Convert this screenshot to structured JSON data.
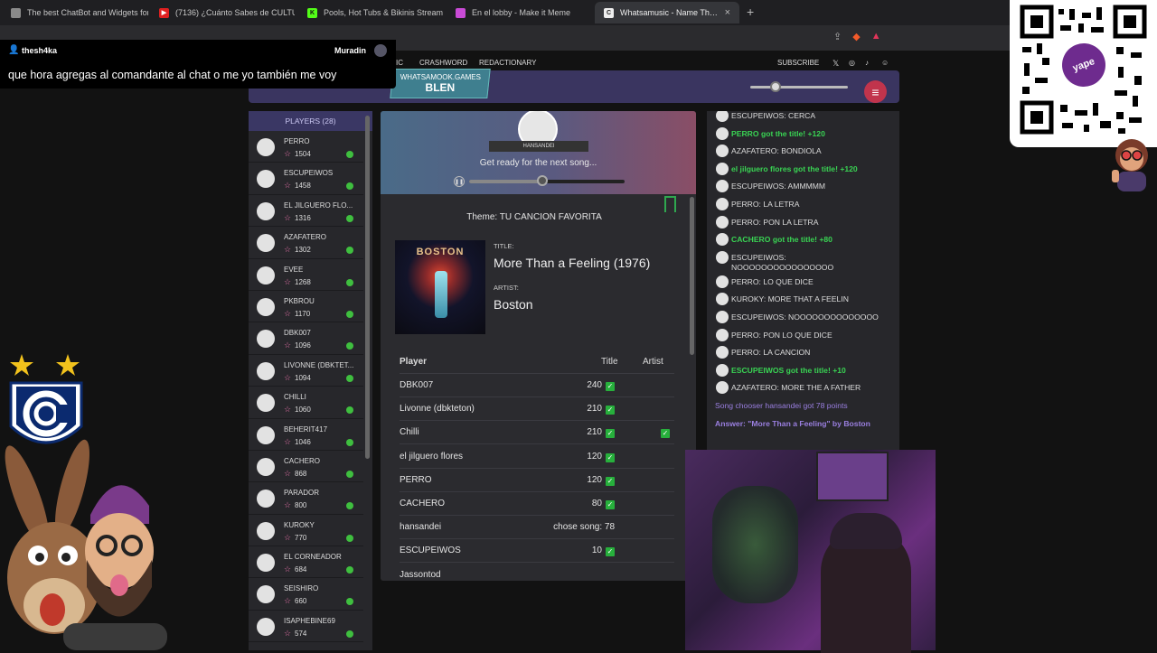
{
  "browser": {
    "tabs": [
      {
        "title": "The best ChatBot and Widgets for Ki",
        "icon_color": "#8a8a8a"
      },
      {
        "title": "(7136) ¿Cuánto Sabes de CULTURA G",
        "icon_color": "#e02020"
      },
      {
        "title": "Pools, Hot Tubs & Bikinis Streaming",
        "icon_color": "#53fc18"
      },
      {
        "title": "En el lobby - Make it Meme",
        "icon_color": "#c94bd6"
      },
      {
        "title": "Whatsamusic - Name That Tune",
        "icon_color": "#2b2b2b",
        "active": true
      }
    ],
    "close_icon": "×",
    "new_tab_icon": "+"
  },
  "site": {
    "nav": {
      "music": "IC",
      "crashword": "CRASHWORD",
      "redactionary": "REDACTIONARY",
      "subscribe": "SUBSCRIBE"
    },
    "badge": {
      "line1": "WHATSAMOOK.GAMES",
      "line2": "BLEN"
    },
    "menu_icon": "≡"
  },
  "players": {
    "header": "PLAYERS (28)",
    "list": [
      {
        "name": "PERRO",
        "score": "1504"
      },
      {
        "name": "ESCUPEIWOS",
        "score": "1458"
      },
      {
        "name": "EL JILGUERO FLO...",
        "score": "1316"
      },
      {
        "name": "AZAFATERO",
        "score": "1302"
      },
      {
        "name": "EVEE",
        "score": "1268"
      },
      {
        "name": "PKBROU",
        "score": "1170"
      },
      {
        "name": "DBK007",
        "score": "1096"
      },
      {
        "name": "LIVONNE (DBKTET...",
        "score": "1094"
      },
      {
        "name": "CHILLI",
        "score": "1060"
      },
      {
        "name": "BEHERIT417",
        "score": "1046"
      },
      {
        "name": "CACHERO",
        "score": "868"
      },
      {
        "name": "PARADOR",
        "score": "800"
      },
      {
        "name": "KUROKY",
        "score": "770"
      },
      {
        "name": "EL CORNEADOR",
        "score": "684"
      },
      {
        "name": "SEISHIRO",
        "score": "660"
      },
      {
        "name": "ISAPHEBINE69",
        "score": "574"
      }
    ]
  },
  "round": {
    "host": "HANSANDEI",
    "status": "Get ready for the next song...",
    "progress": 0.47,
    "theme": "Theme: TU CANCION FAVORITA",
    "title_label": "TITLE:",
    "title": "More Than a Feeling (1976)",
    "artist_label": "ARTIST:",
    "artist": "Boston",
    "album_word": "BOSTON"
  },
  "scores": {
    "headers": {
      "player": "Player",
      "title": "Title",
      "artist": "Artist"
    },
    "rows": [
      {
        "player": "DBK007",
        "title": "240",
        "title_check": true,
        "artist_check": false
      },
      {
        "player": "Livonne (dbkteton)",
        "title": "210",
        "title_check": true,
        "artist_check": false
      },
      {
        "player": "Chilli",
        "title": "210",
        "title_check": true,
        "artist_check": true
      },
      {
        "player": "el jilguero flores",
        "title": "120",
        "title_check": true,
        "artist_check": false
      },
      {
        "player": "PERRO",
        "title": "120",
        "title_check": true,
        "artist_check": false
      },
      {
        "player": "CACHERO",
        "title": "80",
        "title_check": true,
        "artist_check": false
      },
      {
        "player": "hansandei",
        "title": "chose song: 78",
        "title_check": false,
        "artist_check": false
      },
      {
        "player": "ESCUPEIWOS",
        "title": "10",
        "title_check": true,
        "artist_check": false
      },
      {
        "player": "Jassontod",
        "title": "",
        "title_check": false,
        "artist_check": false
      }
    ]
  },
  "chat": [
    {
      "text": "ESCUPEIWOS: CERCA",
      "style": "normal"
    },
    {
      "text": "PERRO got the title! +120",
      "style": "green"
    },
    {
      "text": "AZAFATERO: BONDIOLA",
      "style": "normal"
    },
    {
      "text": "el jilguero flores got the title! +120",
      "style": "green"
    },
    {
      "text": "ESCUPEIWOS: AMMMMM",
      "style": "normal"
    },
    {
      "text": "PERRO: LA LETRA",
      "style": "normal"
    },
    {
      "text": "PERRO: PON LA LETRA",
      "style": "normal"
    },
    {
      "text": "CACHERO got the title! +80",
      "style": "green"
    },
    {
      "text": "ESCUPEIWOS: NOOOOOOOOOOOOOOOO",
      "style": "normal"
    },
    {
      "text": "PERRO: LO QUE DICE",
      "style": "normal"
    },
    {
      "text": "KUROKY: MORE THAT A FEELIN",
      "style": "normal"
    },
    {
      "text": "ESCUPEIWOS: NOOOOOOOOOOOOOO",
      "style": "normal"
    },
    {
      "text": "PERRO: PON LO QUE DICE",
      "style": "normal"
    },
    {
      "text": "PERRO: LA CANCION",
      "style": "normal"
    },
    {
      "text": "ESCUPEIWOS got the title! +10",
      "style": "green"
    },
    {
      "text": "AZAFATERO: MORE THE A FATHER",
      "style": "normal"
    },
    {
      "text": "Song chooser hansandei got 78 points",
      "style": "purple"
    },
    {
      "text": "Answer: \"More Than a Feeling\" by Boston",
      "style": "purple-bold"
    }
  ],
  "overlay": {
    "alert_user": "thesh4ka",
    "alert_target": "Muradin",
    "alert_message": "que hora agregas al comandante al chat o me yo también me voy",
    "qr_brand": "yape"
  }
}
